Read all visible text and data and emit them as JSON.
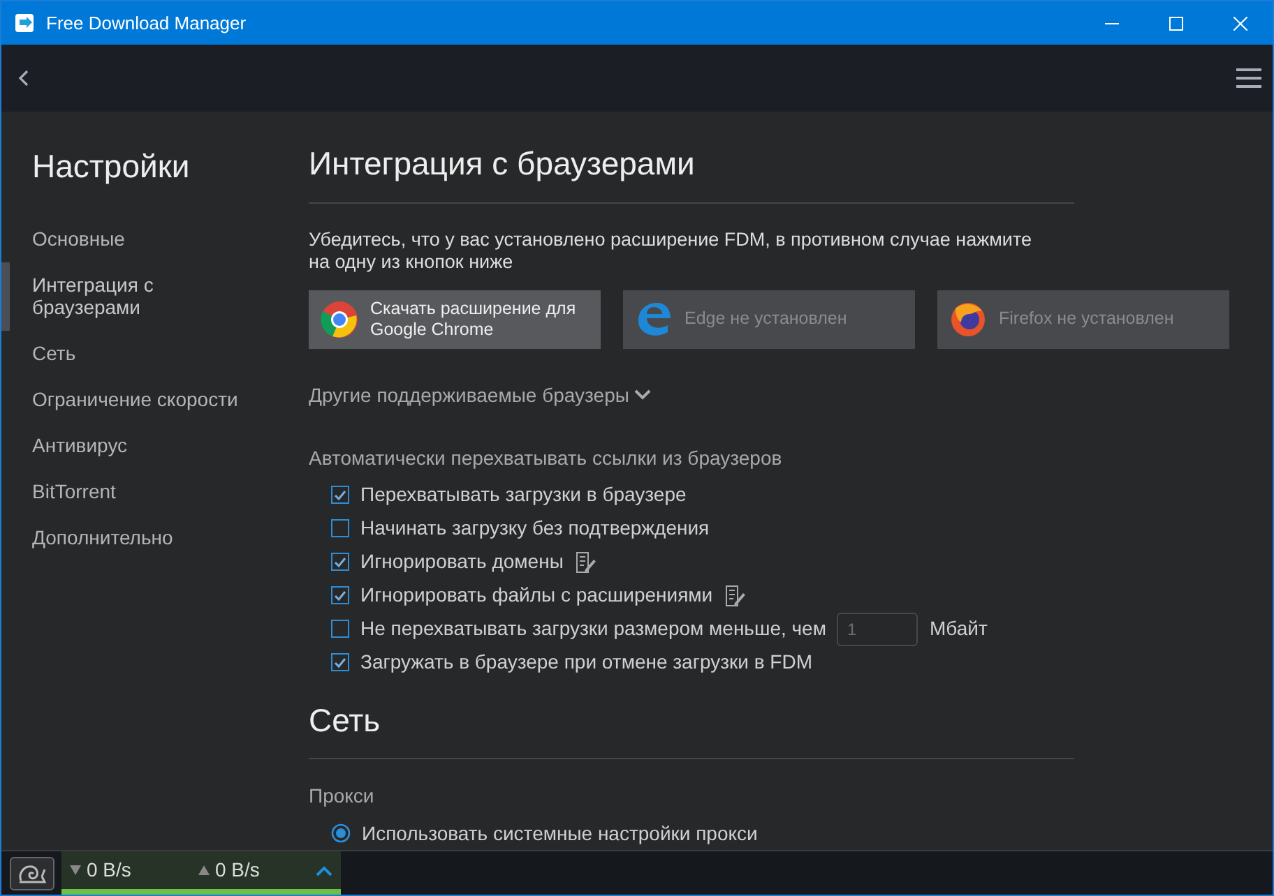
{
  "window": {
    "title": "Free Download Manager"
  },
  "sidebar": {
    "title": "Настройки",
    "items": [
      {
        "label": "Основные",
        "selected": false
      },
      {
        "label": "Интеграция с браузерами",
        "selected": true
      },
      {
        "label": "Сеть",
        "selected": false
      },
      {
        "label": "Ограничение скорости",
        "selected": false
      },
      {
        "label": "Антивирус",
        "selected": false
      },
      {
        "label": "BitTorrent",
        "selected": false
      },
      {
        "label": "Дополнительно",
        "selected": false
      }
    ]
  },
  "browser_integration": {
    "title": "Интеграция с браузерами",
    "description": "Убедитесь, что у вас установлено расширение FDM, в противном случае нажмите на одну из кнопок ниже",
    "browsers": [
      {
        "kind": "chrome",
        "label": "Скачать расширение для Google Chrome",
        "disabled": false
      },
      {
        "kind": "edge",
        "label": "Edge не установлен",
        "disabled": true
      },
      {
        "kind": "firefox",
        "label": "Firefox не установлен",
        "disabled": true
      }
    ],
    "other_browsers": {
      "label": "Другие поддерживаемые браузеры",
      "expanded": false
    },
    "intercept_title": "Автоматически перехватывать ссылки из браузеров",
    "options": [
      {
        "kind": "plain",
        "label": "Перехватывать загрузки в браузере",
        "checked": true
      },
      {
        "kind": "plain",
        "label": "Начинать загрузку без подтверждения",
        "checked": false
      },
      {
        "kind": "editable",
        "label": "Игнорировать домены",
        "checked": true
      },
      {
        "kind": "editable",
        "label": "Игнорировать файлы с расширениями",
        "checked": true
      },
      {
        "kind": "size",
        "label": "Не перехватывать загрузки размером меньше, чем",
        "checked": false,
        "placeholder": "1",
        "unit": "Мбайт"
      },
      {
        "kind": "plain",
        "label": "Загружать в браузере при отмене загрузки в FDM",
        "checked": true
      }
    ]
  },
  "network": {
    "title": "Сеть",
    "proxy_title": "Прокси",
    "proxy_options": [
      {
        "label": "Использовать системные настройки прокси",
        "selected": true
      }
    ]
  },
  "status_bar": {
    "download_speed": "0 B/s",
    "upload_speed": "0 B/s"
  }
}
